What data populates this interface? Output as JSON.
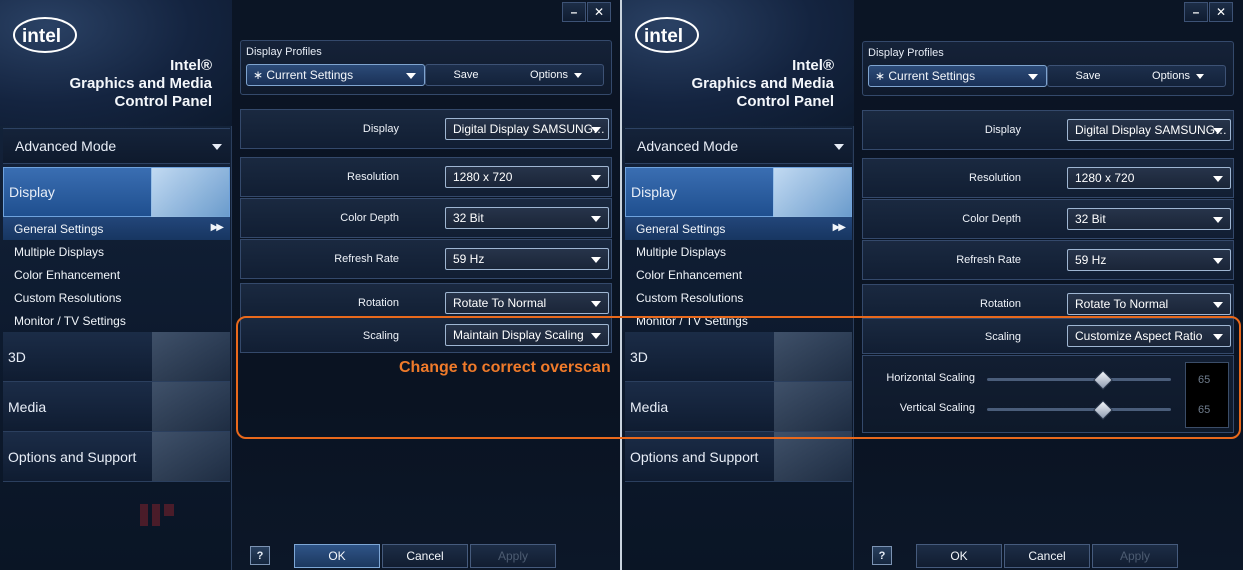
{
  "brand": {
    "logo_text": "intel",
    "title_lines": [
      "Intel®",
      "Graphics and Media",
      "Control Panel"
    ]
  },
  "sidebar": {
    "mode": "Advanced Mode",
    "categories": [
      "Display",
      "3D",
      "Media",
      "Options and Support"
    ],
    "sub_items": [
      "General Settings",
      "Multiple Displays",
      "Color Enhancement",
      "Custom Resolutions",
      "Monitor / TV Settings"
    ]
  },
  "window_buttons": {
    "minimize": "–",
    "close": "✕"
  },
  "profiles": {
    "title": "Display Profiles",
    "current": "∗ Current Settings",
    "save": "Save",
    "options": "Options"
  },
  "labels": {
    "display": "Display",
    "resolution": "Resolution",
    "color_depth": "Color Depth",
    "refresh_rate": "Refresh Rate",
    "rotation": "Rotation",
    "scaling": "Scaling",
    "horizontal_scaling": "Horizontal Scaling",
    "vertical_scaling": "Vertical Scaling"
  },
  "left_values": {
    "display": "Digital Display SAMSUNG…",
    "resolution": "1280 x 720",
    "color_depth": "32 Bit",
    "refresh_rate": "59 Hz",
    "rotation": "Rotate To Normal",
    "scaling": "Maintain Display Scaling"
  },
  "right_values": {
    "display": "Digital Display SAMSUNG…",
    "resolution": "1280 x 720",
    "color_depth": "32 Bit",
    "refresh_rate": "59 Hz",
    "rotation": "Rotate To Normal",
    "scaling": "Customize Aspect Ratio",
    "horizontal_scaling": "65",
    "vertical_scaling": "65",
    "horizontal_slider_fraction": 0.63,
    "vertical_slider_fraction": 0.63
  },
  "footer": {
    "help": "?",
    "ok": "OK",
    "cancel": "Cancel",
    "apply": "Apply"
  },
  "annotation": "Change to correct overscan",
  "colors": {
    "accent_orange": "#e9691c",
    "selected_blue": "#2f5fa0",
    "background": "#0b1525"
  }
}
